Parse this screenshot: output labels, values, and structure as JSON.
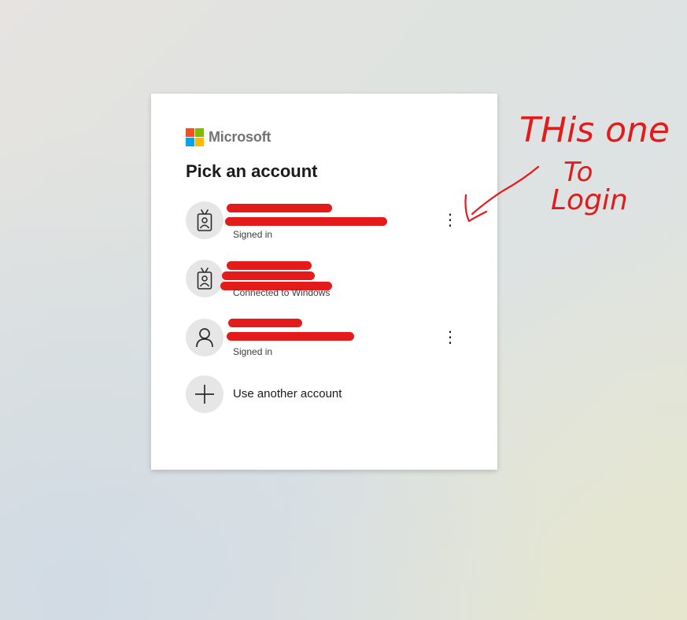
{
  "brand": {
    "name": "Microsoft",
    "colors": [
      "#f25022",
      "#7fba00",
      "#00a4ef",
      "#ffb900"
    ]
  },
  "dialog": {
    "title": "Pick an account",
    "accounts": [
      {
        "icon": "badge-person-icon",
        "status": "Signed in",
        "has_menu": true
      },
      {
        "icon": "badge-person-icon",
        "status": "Connected to Windows",
        "has_menu": false
      },
      {
        "icon": "person-icon",
        "status": "Signed in",
        "has_menu": true
      }
    ],
    "add_account_label": "Use another account",
    "menu_glyph": "⋮"
  },
  "annotation": {
    "text_line1": "THis one",
    "text_line2": "To",
    "text_line3": "Login",
    "color": "#e31b1b"
  },
  "redaction_color": "#e31b1b"
}
